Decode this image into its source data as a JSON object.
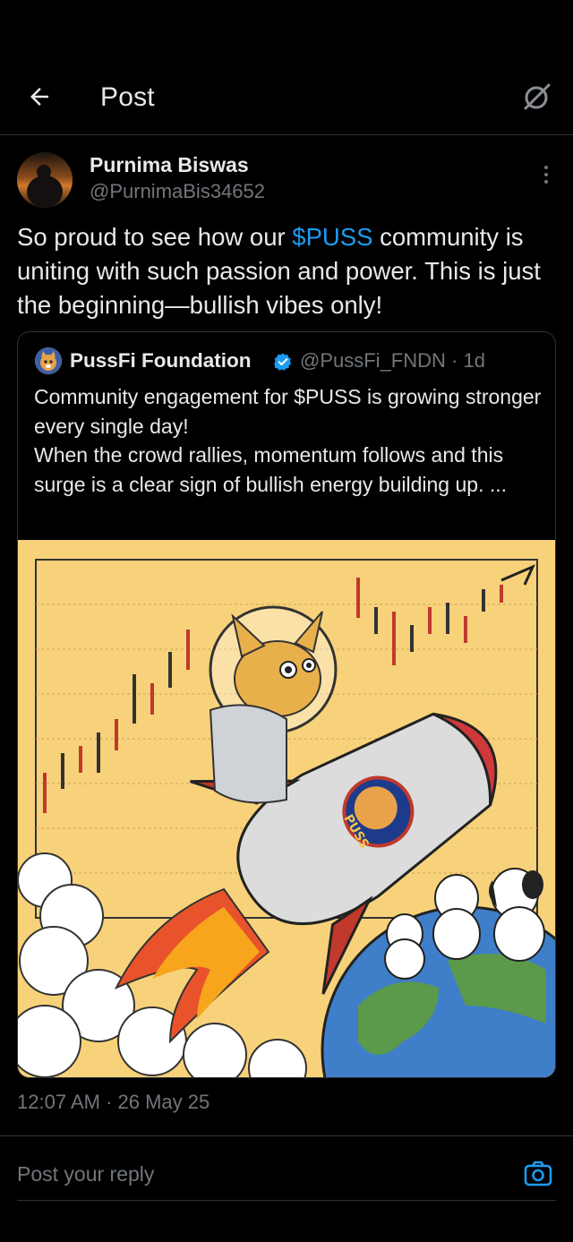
{
  "header": {
    "title": "Post",
    "back_icon": "arrow-left-icon",
    "grok_icon": "grok-icon"
  },
  "post": {
    "author_name": "Purnima Biswas",
    "author_handle": "@PurnimaBis34652",
    "text_before": "So proud to see how our ",
    "cashtag": "$PUSS",
    "text_after": " community is uniting with such passion and power. This is just the beginning—bullish vibes only!",
    "timestamp": "12:07 AM · 26 May 25"
  },
  "quote": {
    "name": "PussFi Foundation",
    "handle_time": "@PussFi_FNDN · 1d",
    "line1": "Community engagement for $PUSS is growing stronger every single day!",
    "line2": "When the crowd rallies, momentum follows and this surge is a clear sign of bullish energy building up.  ...",
    "image_badge_text": "PUSS"
  },
  "reply": {
    "placeholder": "Post your reply"
  },
  "colors": {
    "background": "#000000",
    "accent": "#1d9bf0",
    "muted": "#71767b",
    "divider": "#2f3336"
  }
}
